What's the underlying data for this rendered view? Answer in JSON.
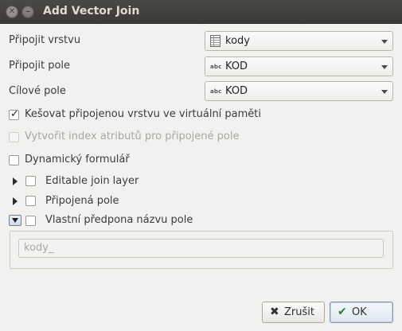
{
  "window": {
    "title": "Add Vector Join"
  },
  "fields": {
    "join_layer": {
      "label": "Připojit vrstvu",
      "value": "kody",
      "icon": "table-layer-icon"
    },
    "join_field": {
      "label": "Připojit pole",
      "value": "KOD",
      "type_badge": "abc"
    },
    "target_field": {
      "label": "Cílové pole",
      "value": "KOD",
      "type_badge": "abc"
    }
  },
  "options": {
    "cache": {
      "label": "Kešovat připojenou vrstvu ve virtuální paměti",
      "checked": true
    },
    "attr_index": {
      "label": "Vytvořit index atributů pro připojené pole",
      "checked": false,
      "disabled": true
    },
    "dynamic_form": {
      "label": "Dynamický formulář",
      "checked": false
    }
  },
  "groups": {
    "editable": {
      "label": "Editable join layer",
      "expanded": false
    },
    "joined_fields": {
      "label": "Připojená pole",
      "expanded": false
    },
    "prefix": {
      "label": "Vlastní předpona názvu pole",
      "expanded": true,
      "placeholder": "kody_"
    }
  },
  "buttons": {
    "cancel": "Zrušit",
    "ok": "OK"
  }
}
